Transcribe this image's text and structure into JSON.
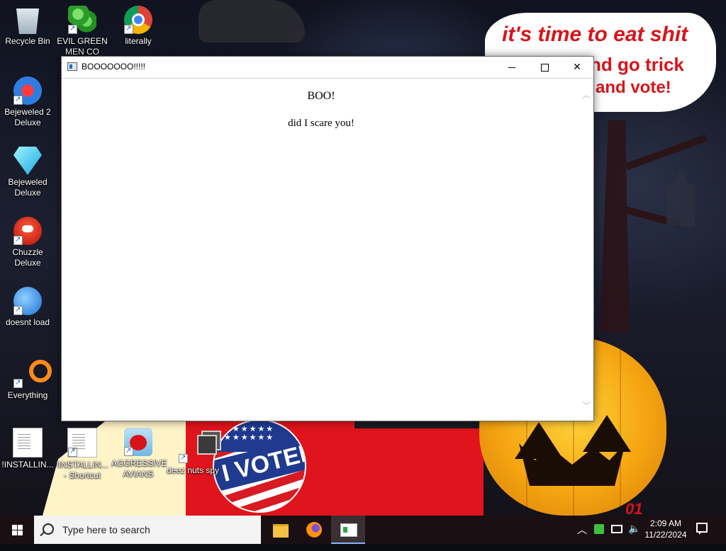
{
  "wallpaper": {
    "speech_bubble": {
      "line1": "it's time to eat shit",
      "line2": "nd go trick",
      "line3": "and vote!"
    },
    "sticker_text": "I VOTED",
    "corner_number": "01"
  },
  "desktop_icons": [
    {
      "label": "Recycle Bin",
      "icon": "recycle-bin-icon"
    },
    {
      "label": "EVIL GREEN MEN CO",
      "icon": "green-men-icon"
    },
    {
      "label": "literally",
      "icon": "chrome-icon"
    },
    {
      "label": "Bejeweled 2 Deluxe",
      "icon": "bejeweled-2-icon"
    },
    {
      "label": "Bejeweled Deluxe",
      "icon": "bejeweled-icon"
    },
    {
      "label": "Chuzzle Deluxe",
      "icon": "chuzzle-icon"
    },
    {
      "label": "doesnt load",
      "icon": "thunderbird-icon"
    },
    {
      "label": "Everything",
      "icon": "everything-icon"
    },
    {
      "label": "!INSTALLIN...",
      "icon": "text-document-icon"
    },
    {
      "label": "!INSTALLIN... - Shortcut",
      "icon": "text-document-icon"
    },
    {
      "label": "AGGRESSIVE AVIANS",
      "icon": "angry-bird-icon"
    },
    {
      "label": "deez nuts spy",
      "icon": "stacked-windows-icon"
    }
  ],
  "window": {
    "title": "BOOOOOOO!!!!!",
    "heading": "BOO!",
    "body": "did I scare you!",
    "buttons": {
      "minimize": "minimize",
      "maximize": "maximize",
      "close": "close"
    }
  },
  "taskbar": {
    "search_placeholder": "Type here to search",
    "apps": [
      "file-explorer",
      "firefox",
      "boo-window"
    ],
    "time": "2:09 AM",
    "date": "11/22/2024"
  },
  "colors": {
    "accent_red": "#d8141a",
    "taskbar": "#1a1013",
    "search_bg": "#f3f3f3"
  }
}
